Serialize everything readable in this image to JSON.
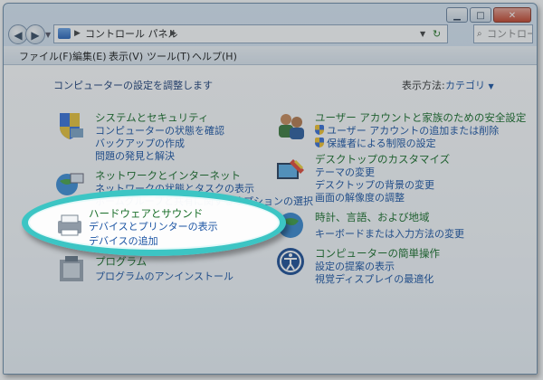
{
  "window": {
    "breadcrumb": [
      "コントロール パネル"
    ],
    "search_placeholder": "コントロール..."
  },
  "menu": [
    "ファイル(F)",
    "編集(E)",
    "表示(V)",
    "ツール(T)",
    "ヘルプ(H)"
  ],
  "header": {
    "title": "コンピューターの設定を調整します",
    "view_label": "表示方法:",
    "view_value": "カテゴリ"
  },
  "categories": {
    "system": {
      "title": "システムとセキュリティ",
      "links": [
        "コンピューターの状態を確認",
        "バックアップの作成",
        "問題の発見と解決"
      ]
    },
    "network": {
      "title": "ネットワークとインターネット",
      "links": [
        "ネットワークの状態とタスクの表示",
        "ホームグループと共有に関するオプションの選択"
      ]
    },
    "hardware": {
      "title": "ハードウェアとサウンド",
      "links": [
        "デバイスとプリンターの表示",
        "デバイスの追加"
      ]
    },
    "programs": {
      "title": "プログラム",
      "links": [
        "プログラムのアンインストール"
      ]
    },
    "users": {
      "title": "ユーザー アカウントと家族のための安全設定",
      "links": [
        "ユーザー アカウントの追加または削除",
        "保護者による制限の設定"
      ]
    },
    "appearance": {
      "title": "デスクトップのカスタマイズ",
      "links": [
        "テーマの変更",
        "デスクトップの背景の変更",
        "画面の解像度の調整"
      ]
    },
    "clock": {
      "title": "時計、言語、および地域",
      "links": [
        "キーボードまたは入力方法の変更"
      ]
    },
    "ease": {
      "title": "コンピューターの簡単操作",
      "links": [
        "設定の提案の表示",
        "視覚ディスプレイの最適化"
      ]
    }
  }
}
